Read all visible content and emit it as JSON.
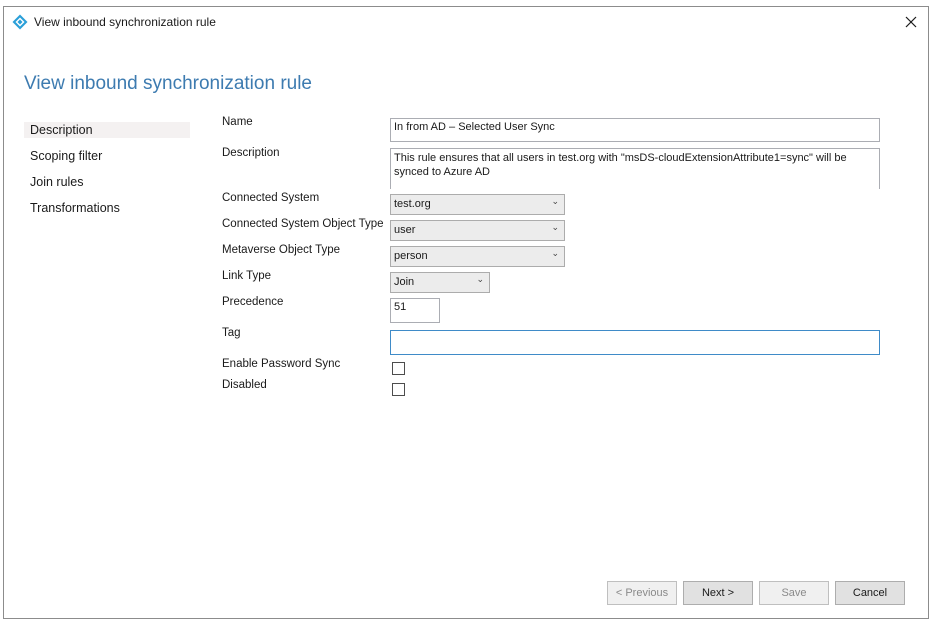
{
  "window": {
    "title": "View inbound synchronization rule"
  },
  "page": {
    "heading": "View inbound synchronization rule"
  },
  "nav": [
    {
      "label": "Description",
      "selected": true
    },
    {
      "label": "Scoping filter",
      "selected": false
    },
    {
      "label": "Join rules",
      "selected": false
    },
    {
      "label": "Transformations",
      "selected": false
    }
  ],
  "form": {
    "name": {
      "label": "Name",
      "value": "In from AD – Selected User Sync"
    },
    "description": {
      "label": "Description",
      "value": "This rule ensures that all users in test.org with \"msDS-cloudExtensionAttribute1=sync\"  will be synced to Azure AD"
    },
    "connected_system": {
      "label": "Connected System",
      "value": "test.org"
    },
    "connected_system_object_type": {
      "label": "Connected System Object Type",
      "value": "user"
    },
    "metaverse_object_type": {
      "label": "Metaverse Object Type",
      "value": "person"
    },
    "link_type": {
      "label": "Link Type",
      "value": "Join"
    },
    "precedence": {
      "label": "Precedence",
      "value": "51"
    },
    "tag": {
      "label": "Tag",
      "value": ""
    },
    "enable_password_sync": {
      "label": "Enable Password Sync",
      "checked": false
    },
    "disabled": {
      "label": "Disabled",
      "checked": false
    }
  },
  "buttons": {
    "previous": "< Previous",
    "next": "Next >",
    "save": "Save",
    "cancel": "Cancel"
  },
  "icons": {
    "app": "azure-ad-diamond-icon",
    "close": "close-icon",
    "dropdown": "chevron-down-icon"
  },
  "colors": {
    "heading": "#3d7bb0",
    "focus_border": "#3f8bc8",
    "app_icon": "#2a9fd8"
  }
}
